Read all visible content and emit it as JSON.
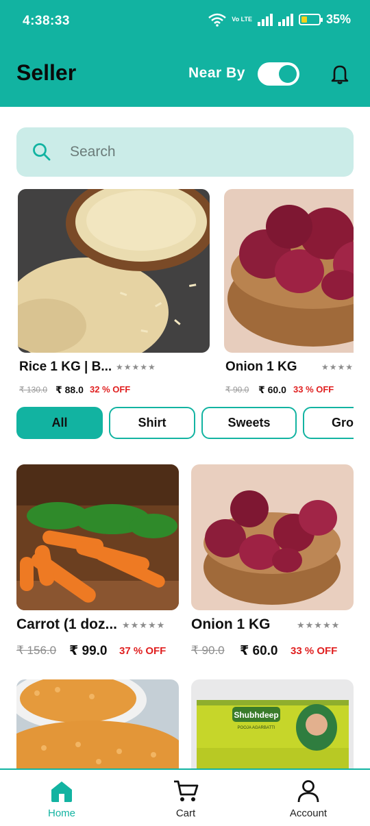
{
  "status_bar": {
    "time": "4:38:33",
    "network": "Vo LTE",
    "battery": "35%",
    "battery_level": 0.35
  },
  "app_bar": {
    "title": "Seller",
    "near_by_label": "Near By",
    "near_by_on": true
  },
  "search": {
    "placeholder": "Search"
  },
  "featured": [
    {
      "name": "Rice 1 KG | B...",
      "mrp": "₹ 130.0",
      "price": "₹ 88.0",
      "discount": "32 % OFF",
      "image": "rice"
    },
    {
      "name": "Onion 1 KG",
      "mrp": "₹ 90.0",
      "price": "₹ 60.0",
      "discount": "33 % OFF",
      "image": "onion"
    }
  ],
  "categories": [
    {
      "label": "All",
      "active": true
    },
    {
      "label": "Shirt",
      "active": false
    },
    {
      "label": "Sweets",
      "active": false
    },
    {
      "label": "Groc",
      "active": false
    }
  ],
  "products": [
    {
      "name": "Carrot (1 doz...",
      "mrp": "₹ 156.0",
      "price": "₹ 99.0",
      "discount": "37 % OFF",
      "image": "carrot"
    },
    {
      "name": "Onion 1 KG",
      "mrp": "₹ 90.0",
      "price": "₹ 60.0",
      "discount": "33 % OFF",
      "image": "onion"
    },
    {
      "name": "",
      "image": "chana-dal"
    },
    {
      "name": "",
      "image": "agarbatti",
      "brand": "Shubhdeep",
      "sub": "POOJA AGARBATTI"
    }
  ],
  "stars": "★★★★★",
  "bottom_nav": [
    {
      "label": "Home",
      "icon": "home-icon",
      "active": true
    },
    {
      "label": "Cart",
      "icon": "cart-icon",
      "active": false
    },
    {
      "label": "Account",
      "icon": "account-icon",
      "active": false
    }
  ],
  "colors": {
    "primary": "#12b3a1",
    "search_bg": "#cbece8",
    "discount": "#e02020"
  }
}
